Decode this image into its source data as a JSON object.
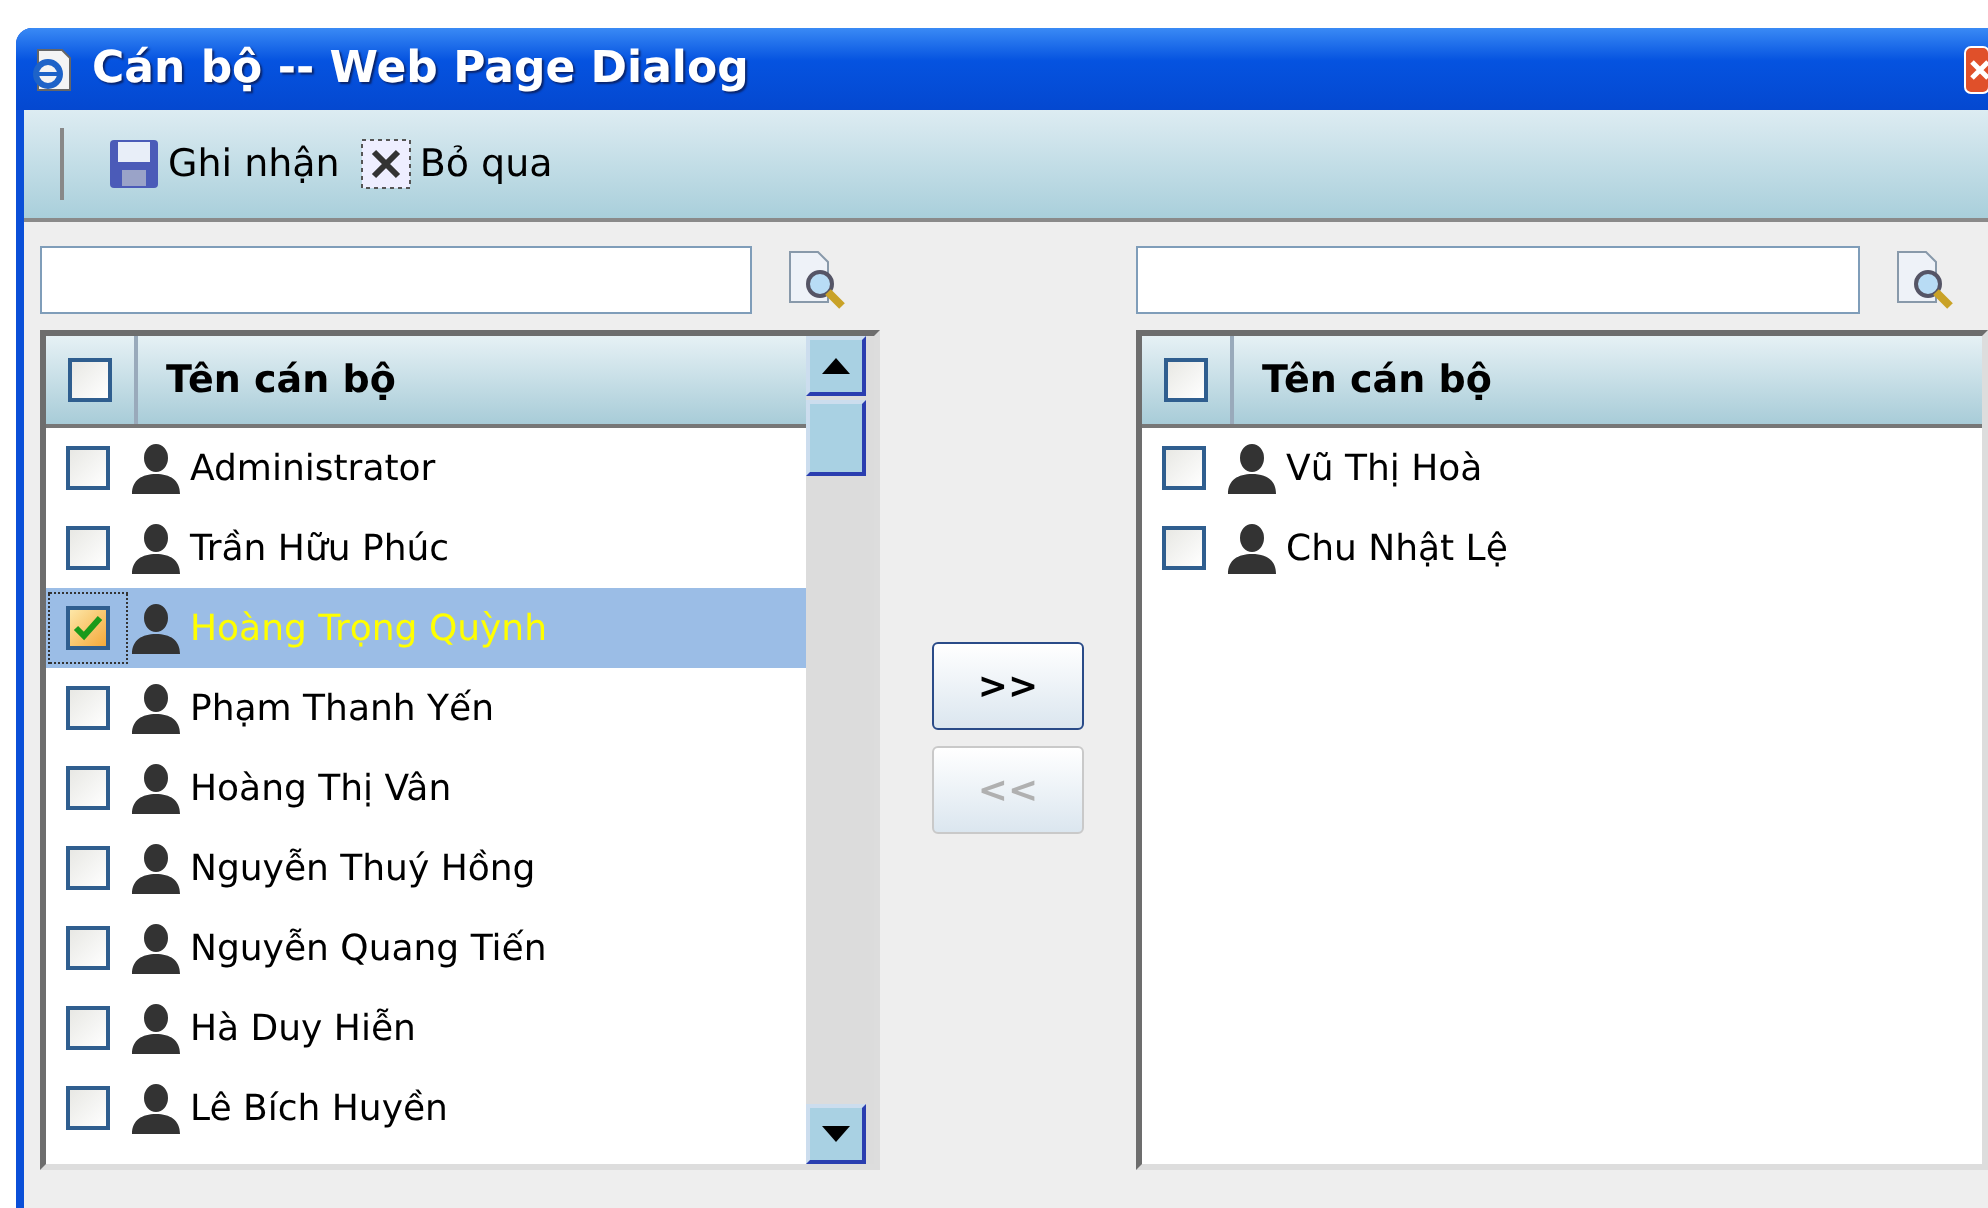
{
  "window": {
    "title": "Cán bộ -- Web Page Dialog"
  },
  "toolbar": [
    {
      "kind": "save",
      "label": "Ghi nhận"
    },
    {
      "kind": "cancel",
      "label": "Bỏ qua"
    }
  ],
  "left": {
    "header": {
      "label": "Tên cán bộ",
      "checked": false
    },
    "rows": [
      {
        "name": "Administrator",
        "checked": false,
        "selected": false
      },
      {
        "name": "Trần Hữu Phúc",
        "checked": false,
        "selected": false
      },
      {
        "name": "Hoàng Trọng Quỳnh",
        "checked": true,
        "selected": true
      },
      {
        "name": "Phạm Thanh Yến",
        "checked": false,
        "selected": false
      },
      {
        "name": "Hoàng Thị Vân",
        "checked": false,
        "selected": false
      },
      {
        "name": "Nguyễn Thuý Hồng",
        "checked": false,
        "selected": false
      },
      {
        "name": "Nguyễn Quang Tiến",
        "checked": false,
        "selected": false
      },
      {
        "name": "Hà Duy Hiễn",
        "checked": false,
        "selected": false
      },
      {
        "name": "Lê Bích Huyền",
        "checked": false,
        "selected": false
      }
    ]
  },
  "move_buttons": [
    {
      "label": ">>",
      "disabled": false
    },
    {
      "label": "<<",
      "disabled": true
    }
  ],
  "right": {
    "header": {
      "label": "Tên cán bộ",
      "checked": false
    },
    "rows": [
      {
        "name": "Vũ Thị Hoà",
        "checked": false,
        "selected": false
      },
      {
        "name": "Chu Nhật Lệ",
        "checked": false,
        "selected": false
      }
    ]
  }
}
